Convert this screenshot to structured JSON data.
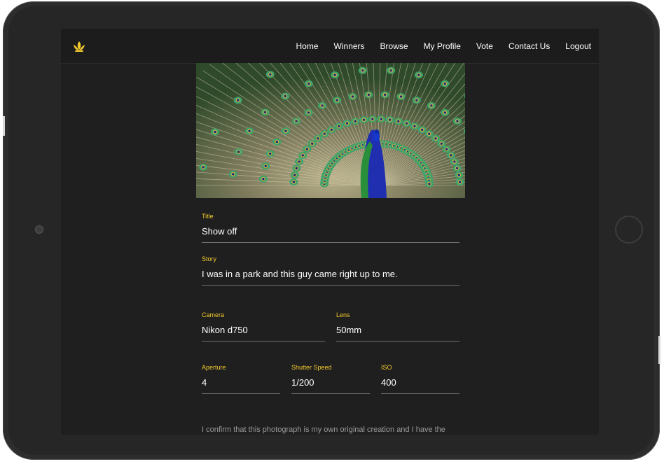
{
  "nav": {
    "logo_icon": "lotus-logo-icon",
    "items": [
      {
        "label": "Home"
      },
      {
        "label": "Winners"
      },
      {
        "label": "Browse"
      },
      {
        "label": "My Profile"
      },
      {
        "label": "Vote"
      },
      {
        "label": "Contact Us"
      },
      {
        "label": "Logout"
      }
    ]
  },
  "photo": {
    "subject": "peacock photo"
  },
  "form": {
    "title": {
      "label": "Title",
      "value": "Show off"
    },
    "story": {
      "label": "Story",
      "value": "I was in a park and this guy came right up to me."
    },
    "camera": {
      "label": "Camera",
      "value": "Nikon d750"
    },
    "lens": {
      "label": "Lens",
      "value": "50mm"
    },
    "aperture": {
      "label": "Aperture",
      "value": "4"
    },
    "shutter_speed": {
      "label": "Shutter Speed",
      "value": "1/200"
    },
    "iso": {
      "label": "ISO",
      "value": "400"
    }
  },
  "confirm_text": "I confirm that this photograph is my own original creation and I have the",
  "colors": {
    "accent": "#f5cb2e",
    "background": "#1f1f1f",
    "device": "#2d2d2d"
  }
}
